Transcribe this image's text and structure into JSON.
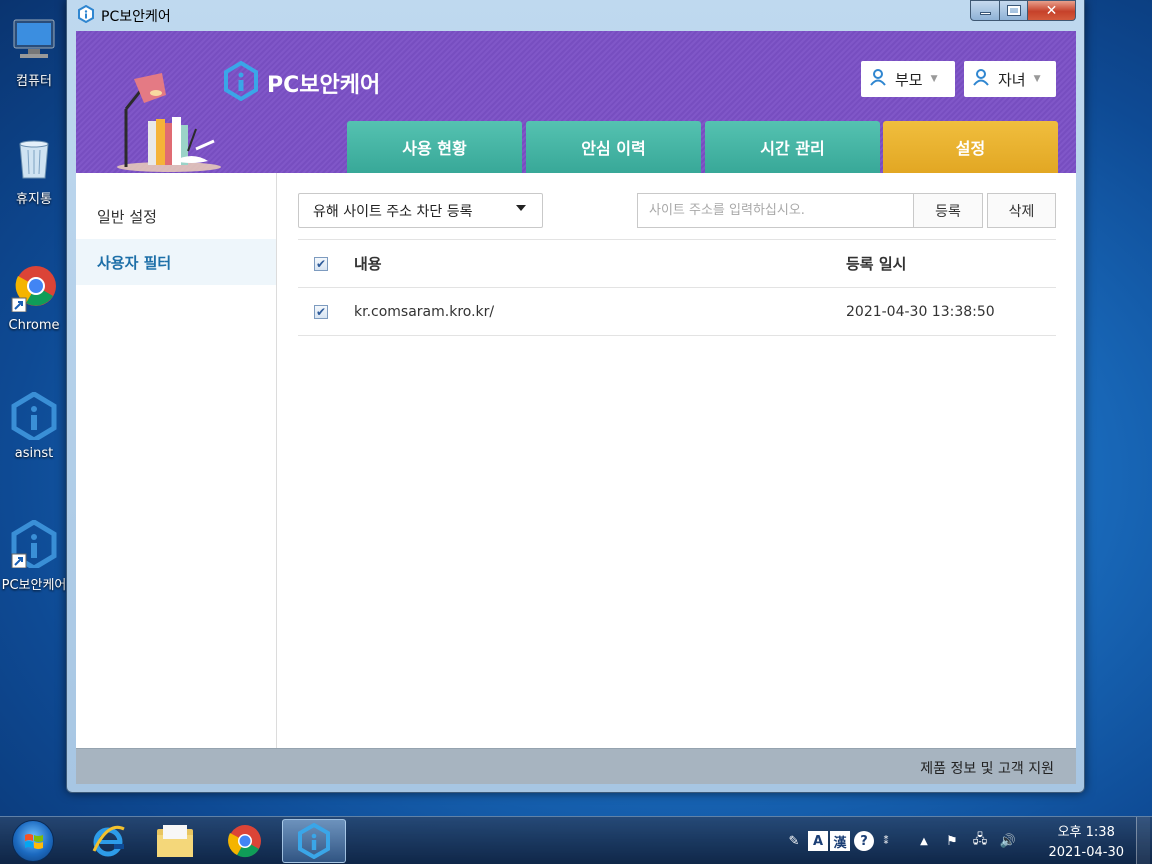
{
  "desktop": {
    "icons": [
      {
        "label": "컴퓨터"
      },
      {
        "label": "휴지통"
      },
      {
        "label": "Chrome"
      },
      {
        "label": "asinst"
      },
      {
        "label": "PC보안케어"
      }
    ]
  },
  "window": {
    "title": "PC보안케어"
  },
  "header": {
    "logo_text": "PC보안케어",
    "parent_label": "부모",
    "child_label": "자녀",
    "tabs": [
      {
        "label": "사용 현황"
      },
      {
        "label": "안심 이력"
      },
      {
        "label": "시간 관리"
      },
      {
        "label": "설정"
      }
    ],
    "active_tab": "설정"
  },
  "sidebar": {
    "items": [
      {
        "label": "일반 설정"
      },
      {
        "label": "사용자 필터"
      }
    ],
    "active": "사용자 필터"
  },
  "filter": {
    "mode_selected": "유해 사이트 주소 차단 등록",
    "url_placeholder": "사이트 주소를 입력하십시오.",
    "register_label": "등록",
    "delete_label": "삭제"
  },
  "table": {
    "headers": {
      "content": "내용",
      "date": "등록 일시"
    },
    "rows": [
      {
        "content": "kr.comsaram.kro.kr/",
        "date": "2021-04-30 13:38:50",
        "checked": true
      }
    ]
  },
  "footer": {
    "support_label": "제품 정보 및 고객 지원"
  },
  "taskbar": {
    "clock_time": "오후 1:38",
    "clock_date": "2021-04-30"
  },
  "colors": {
    "header_purple": "#7b50c6",
    "tab_teal": "#44b3a3",
    "tab_active_gold": "#e8b02e",
    "footer_gray": "#a7b4c0",
    "accent_blue": "#1d6fa8"
  }
}
